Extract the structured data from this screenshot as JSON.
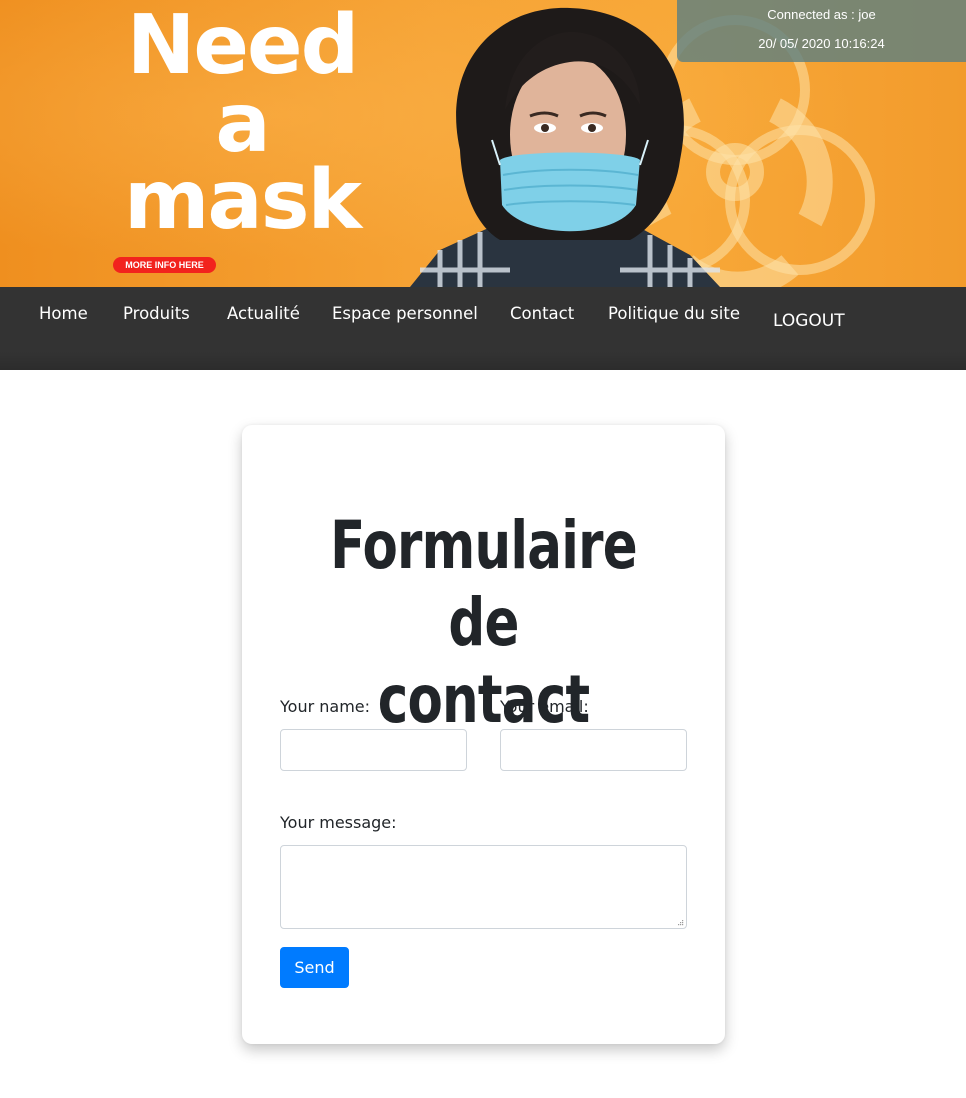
{
  "banner": {
    "headline": [
      "Need",
      "a",
      "mask"
    ],
    "more_info": "MORE INFO HERE",
    "session_user": "Connected as : joe",
    "session_time": "20/ 05/ 2020 10:16:24"
  },
  "nav": {
    "items": [
      "Home",
      "Produits",
      "Actualité",
      "Espace personnel",
      "Contact",
      "Politique du site"
    ],
    "logout": "LOGOUT"
  },
  "form": {
    "title_line1": "Formulaire de",
    "title_line2": "contact",
    "name_label": "Your name:",
    "name_value": "",
    "email_label": "Your email:",
    "email_value": "",
    "message_label": "Your message:",
    "message_value": "",
    "send_label": "Send"
  },
  "colors": {
    "banner_orange": "#f6a335",
    "nav_bg": "#333333",
    "button_blue": "#007bff",
    "more_info_red": "#f2231d",
    "session_bg": "#5f8080"
  }
}
